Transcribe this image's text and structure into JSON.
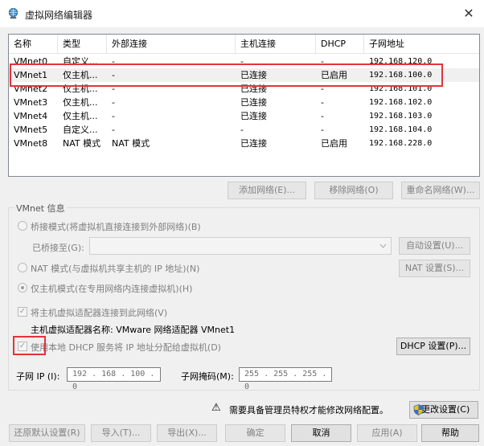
{
  "window": {
    "title": "虚拟网络编辑器",
    "close_glyph": "✕"
  },
  "columns": [
    "名称",
    "类型",
    "外部连接",
    "主机连接",
    "DHCP",
    "子网地址"
  ],
  "rows": [
    {
      "name": "VMnet0",
      "type": "自定义...",
      "external": "-",
      "host": "-",
      "dhcp": "-",
      "subnet": "192.168.120.0"
    },
    {
      "name": "VMnet1",
      "type": "仅主机...",
      "external": "-",
      "host": "已连接",
      "dhcp": "已启用",
      "subnet": "192.168.100.0"
    },
    {
      "name": "VMnet2",
      "type": "仅主机...",
      "external": "-",
      "host": "已连接",
      "dhcp": "-",
      "subnet": "192.168.101.0"
    },
    {
      "name": "VMnet3",
      "type": "仅主机...",
      "external": "-",
      "host": "已连接",
      "dhcp": "-",
      "subnet": "192.168.102.0"
    },
    {
      "name": "VMnet4",
      "type": "仅主机...",
      "external": "-",
      "host": "已连接",
      "dhcp": "-",
      "subnet": "192.168.103.0"
    },
    {
      "name": "VMnet5",
      "type": "自定义...",
      "external": "-",
      "host": "-",
      "dhcp": "-",
      "subnet": "192.168.104.0"
    },
    {
      "name": "VMnet8",
      "type": "NAT 模式",
      "external": "NAT 模式",
      "host": "已连接",
      "dhcp": "已启用",
      "subnet": "192.168.228.0"
    }
  ],
  "network_buttons": {
    "add": "添加网络(E)...",
    "remove": "移除网络(O)",
    "rename": "重命名网络(W)..."
  },
  "info": {
    "group_label": "VMnet 信息",
    "bridged": "桥接模式(将虚拟机直接连接到外部网络)(B)",
    "bridged_to": "已桥接至(G):",
    "auto_settings": "自动设置(U)...",
    "nat": "NAT 模式(与虚拟机共享主机的 IP 地址)(N)",
    "nat_settings": "NAT 设置(S)...",
    "host_only": "仅主机模式(在专用网络内连接虚拟机)(H)",
    "connect_adapter": "将主机虚拟适配器连接到此网络(V)",
    "adapter_name": "主机虚拟适配器名称: VMware 网络适配器 VMnet1",
    "use_dhcp": "使用本地 DHCP 服务将 IP 地址分配给虚拟机(D)",
    "dhcp_settings": "DHCP 设置(P)...",
    "subnet_ip_label": "子网 IP (I):",
    "subnet_ip": "192 . 168 . 100 . 0",
    "subnet_mask_label": "子网掩码(M):",
    "subnet_mask": "255 . 255 . 255 . 0",
    "check_mark": "✓"
  },
  "admin": {
    "warning_glyph": "⚠",
    "text": "需要具备管理员特权才能修改网络配置。",
    "change_settings": "更改设置(C)"
  },
  "footer": {
    "restore": "还原默认设置(R)",
    "import": "导入(T)...",
    "export": "导出(X)...",
    "ok": "确定",
    "cancel": "取消",
    "apply": "应用(A)",
    "help": "帮助"
  },
  "colors": {
    "highlight": "#e5323a",
    "selected_row": "#f0f0f0",
    "disabled_text": "#838383"
  }
}
